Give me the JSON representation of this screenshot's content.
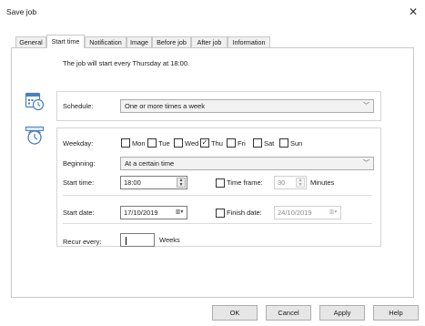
{
  "window": {
    "title": "Save job"
  },
  "tabs": [
    {
      "label": "General",
      "active": false
    },
    {
      "label": "Start time",
      "active": true
    },
    {
      "label": "Notification",
      "active": false
    },
    {
      "label": "Image",
      "active": false
    },
    {
      "label": "Before job",
      "active": false
    },
    {
      "label": "After job",
      "active": false
    },
    {
      "label": "Information",
      "active": false
    }
  ],
  "summary": {
    "text": "The job will start every Thursday at 18:00."
  },
  "schedule": {
    "label": "Schedule:",
    "value": "One or more times a week"
  },
  "weekday": {
    "label": "Weekday:",
    "days": [
      {
        "label": "Mon",
        "checked": false
      },
      {
        "label": "Tue",
        "checked": false
      },
      {
        "label": "Wed",
        "checked": false
      },
      {
        "label": "Thu",
        "checked": true
      },
      {
        "label": "Fri",
        "checked": false
      },
      {
        "label": "Sat",
        "checked": false
      },
      {
        "label": "Sun",
        "checked": false
      }
    ]
  },
  "beginning": {
    "label": "Beginning:",
    "value": "At a certain time"
  },
  "start_time": {
    "label": "Start time:",
    "value": "18:00"
  },
  "time_frame": {
    "label": "Time frame:",
    "value": "30",
    "unit": "Minutes",
    "checked": false
  },
  "start_date": {
    "label": "Start date:",
    "value": "17/10/2019"
  },
  "finish_date": {
    "label": "Finish date:",
    "value": "24/10/2019",
    "checked": false
  },
  "recur": {
    "label": "Recur every:",
    "value": "",
    "unit": "Weeks"
  },
  "buttons": {
    "ok": "OK",
    "cancel": "Cancel",
    "apply": "Apply",
    "help": "Help"
  },
  "colors": {
    "icon_blue": "#4a7fc1",
    "icon_light": "#dbe8f7"
  }
}
